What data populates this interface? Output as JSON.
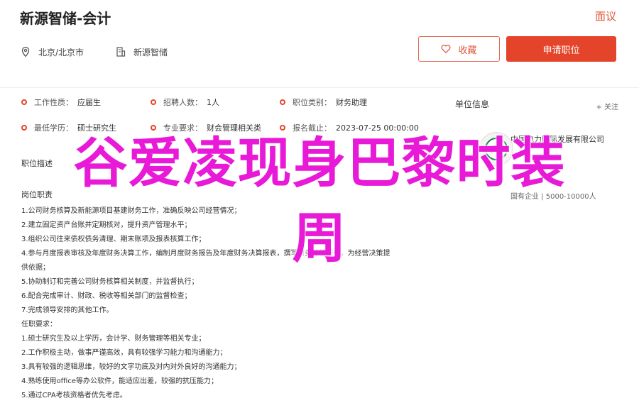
{
  "header": {
    "job_title": "新源智储-会计",
    "report_label": "面议",
    "location": "北京/北京市",
    "company": "新源智储",
    "favorite_label": "收藏",
    "apply_label": "申请职位"
  },
  "info": [
    [
      {
        "k": "工作性质：",
        "v": "应届生"
      },
      {
        "k": "招聘人数：",
        "v": "1人"
      },
      {
        "k": "职位类别：",
        "v": "财务助理"
      }
    ],
    [
      {
        "k": "最低学历：",
        "v": "硕士研究生"
      },
      {
        "k": "专业要求：",
        "v": "财会管理相关类"
      },
      {
        "k": "报名截止：",
        "v": "2023-07-25 00:00:00"
      }
    ]
  ],
  "sections": {
    "desc_label": "职位描述",
    "duty_label": "岗位职责"
  },
  "duties": [
    "1.公司财务核算及新能源项目基建财务工作，准确反映公司经营情况；",
    "2.建立固定资产台账并定期核对，提升资产管理水平；",
    "3.组织公司往来债权债务清理、期末账项及报表核算工作；",
    "4.参与月度报表审核及年度财务决算工作，编制月度财务报告及年度财务决算报表，撰写财务分析报告，为经营决策提",
    "供依据；",
    "5.协助制订和完善公司财务核算相关制度，并监督执行；",
    "6.配合完成审计、财政、税收等相关部门的监督检查；",
    "7.完成领导安排的其他工作。",
    "任职要求：",
    "1.硕士研究生及以上学历，会计学、财务管理等相关专业；",
    "2.工作积极主动，做事严谨高效，具有较强学习能力和沟通能力；",
    "3.具有较强的逻辑思维，较好的文字功底及对内对外良好的沟通能力；",
    "4.熟练使用office等办公软件，能适应出差，较强的抗压能力；",
    "5.通过CPA考核资格者优先考虑。"
  ],
  "company_panel": {
    "title": "单位信息",
    "follow_label": "+ 关注",
    "name": "中国电力国际发展有限公司",
    "meta": "国有企业 | 5000-10000人"
  },
  "overlay": {
    "line1": "谷爱凌现身巴黎时装",
    "line2": "周"
  },
  "colors": {
    "accent": "#e4452a",
    "overlay": "#e81ad8"
  }
}
